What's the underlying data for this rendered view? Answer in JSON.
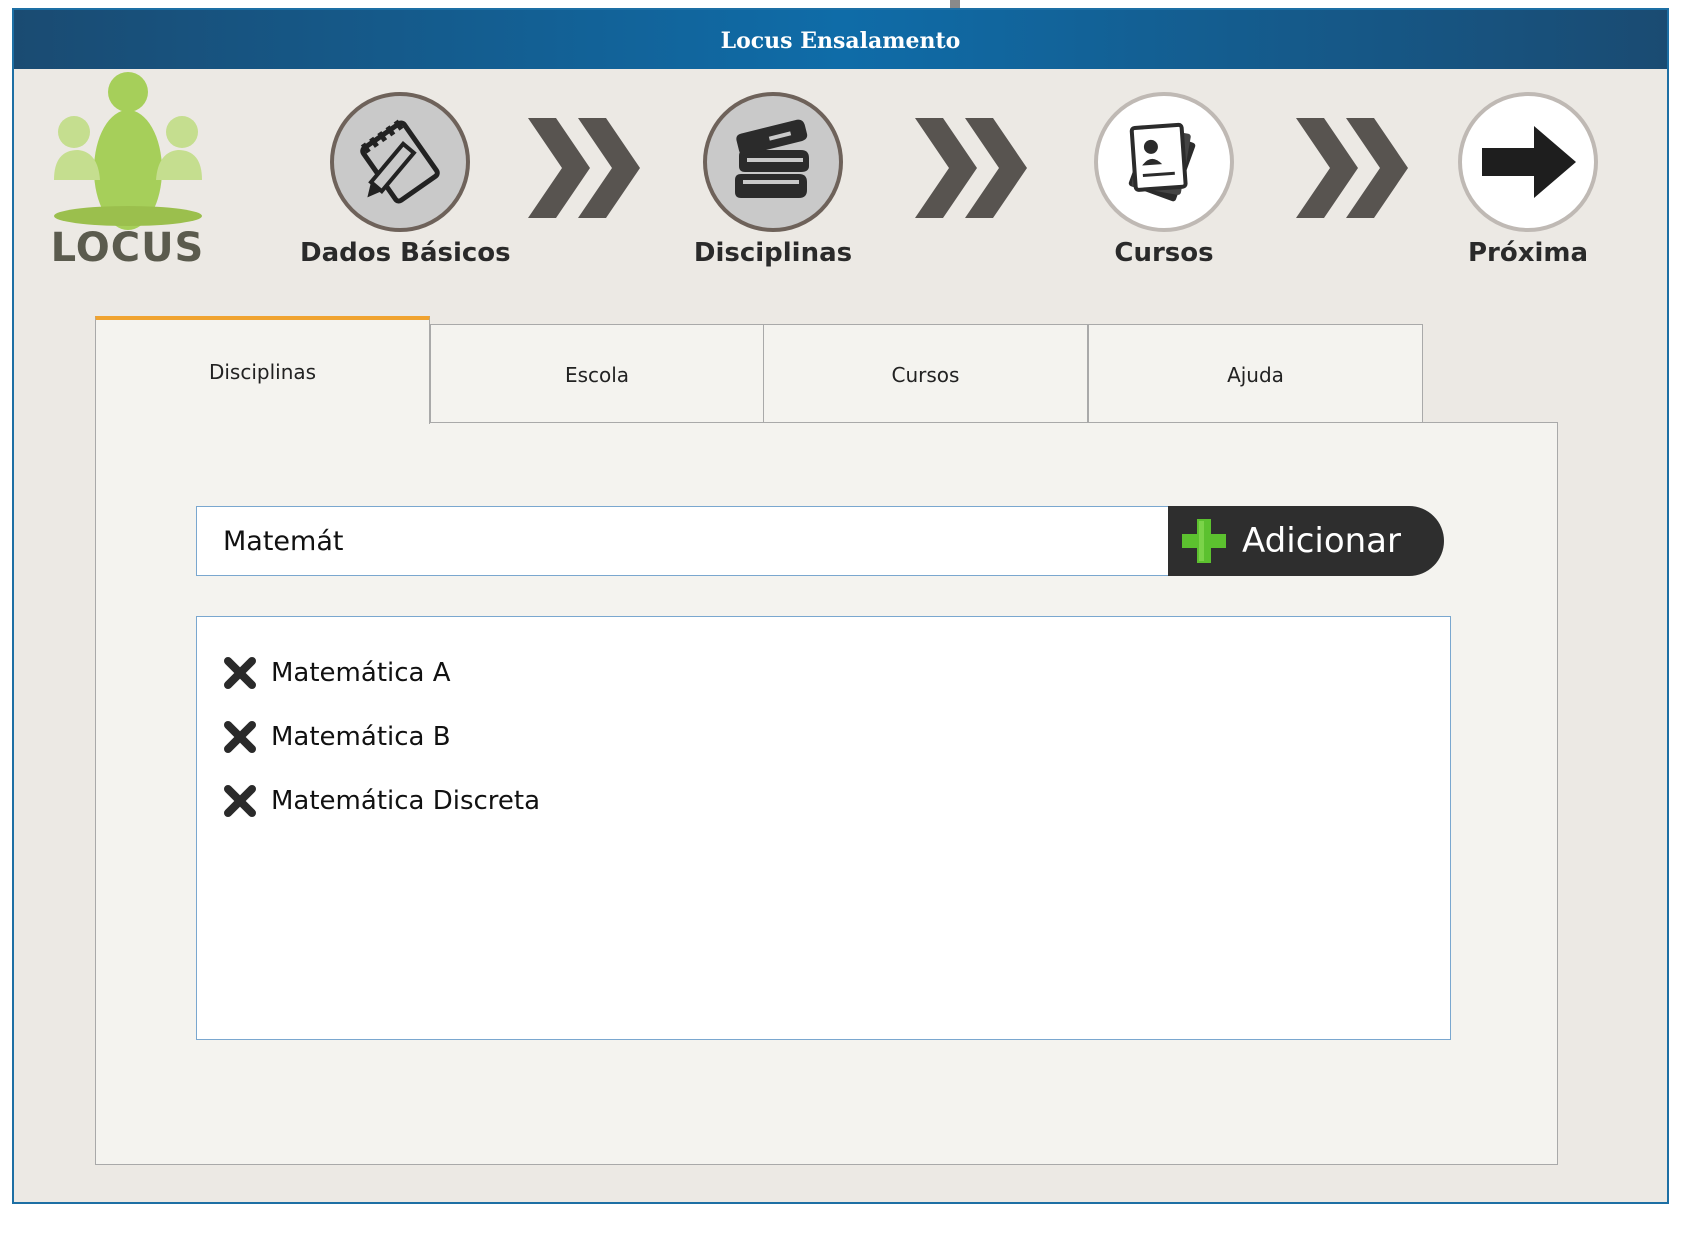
{
  "window": {
    "title": "Locus Ensalamento"
  },
  "logo": {
    "text": "LOCUS"
  },
  "steps": [
    {
      "label": "Dados Básicos",
      "icon": "notepad-pencil-icon",
      "state": "active"
    },
    {
      "label": "Disciplinas",
      "icon": "books-icon",
      "state": "active"
    },
    {
      "label": "Cursos",
      "icon": "id-documents-icon",
      "state": "inactive"
    },
    {
      "label": "Próxima",
      "icon": "arrow-right-icon",
      "state": "inactive"
    }
  ],
  "tabs": [
    {
      "label": "Disciplinas",
      "active": true
    },
    {
      "label": "Escola",
      "active": false
    },
    {
      "label": "Cursos",
      "active": false
    },
    {
      "label": "Ajuda",
      "active": false
    }
  ],
  "search": {
    "value": "Matemát"
  },
  "add_button": {
    "label": "Adicionar"
  },
  "disciplines": [
    {
      "name": "Matemática A"
    },
    {
      "name": "Matemática B"
    },
    {
      "name": "Matemática Discreta"
    }
  ],
  "colors": {
    "title_bar": "#0f6ca8",
    "active_tab_accent": "#f0a330",
    "plus_icon": "#5cc12f",
    "logo_green": "#a6cf5a"
  }
}
